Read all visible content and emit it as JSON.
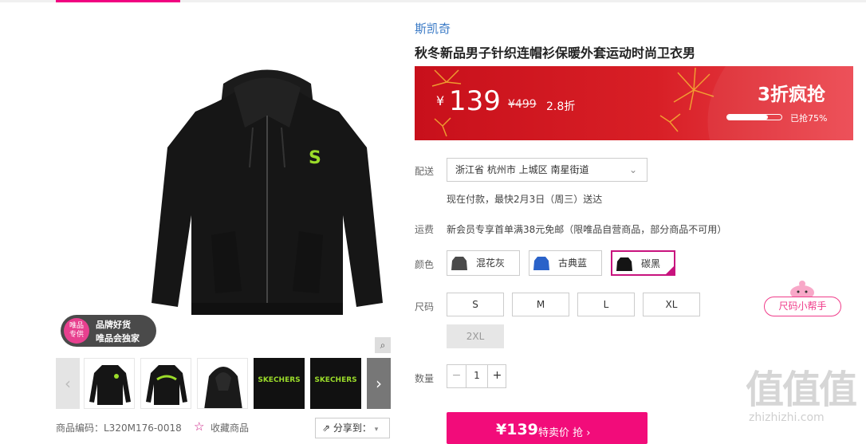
{
  "brand": "斯凯奇",
  "title": "秋冬新品男子针织连帽衫保暖外套运动时尚卫衣男",
  "product_image": {
    "badge_logo_line1": "唯品",
    "badge_logo_line2": "专供",
    "badge_line1": "品牌好货",
    "badge_line2": "唯品会独家",
    "hoodie_logo": "S"
  },
  "thumbnails": {
    "prev_icon": "chevron-left-icon",
    "next_icon": "chevron-right-icon",
    "texts": [
      "SKECHERS",
      "SKECHERS"
    ]
  },
  "sku_code": "商品编码：L320M176-0018",
  "favorite": "收藏商品",
  "share": "分享到：",
  "price_banner": {
    "currency": "¥",
    "price": "139",
    "original": "¥499",
    "discount": "2.8折",
    "promo": "3折疯抢",
    "sold_label": "已抢75%",
    "sold_fraction": 0.75
  },
  "delivery": {
    "label": "配送",
    "address": "浙江省 杭州市 上城区 南星街道",
    "eta": "现在付款，最快2月3日（周三）送达"
  },
  "shipping": {
    "label": "运费",
    "text": "新会员专享首单满38元免邮（限唯品自营商品，部分商品不可用）"
  },
  "colors": {
    "label": "颜色",
    "options": [
      {
        "name": "混花灰",
        "swatch": "#4a4a4a"
      },
      {
        "name": "古典蓝",
        "swatch": "#2a62c9"
      },
      {
        "name": "碳黑",
        "swatch": "#141414"
      }
    ],
    "selected": "碳黑"
  },
  "sizes": {
    "label": "尺码",
    "options": [
      "S",
      "M",
      "L",
      "XL",
      "2XL"
    ],
    "disabled": [
      "2XL"
    ],
    "helper": "尺码小帮手"
  },
  "quantity": {
    "label": "数量",
    "value": "1",
    "minus": "−",
    "plus": "+"
  },
  "buy": {
    "price": "¥139",
    "label": "特卖价 抢 ›"
  },
  "watermark": {
    "big": "值值值",
    "small": "zhizhizhi.com"
  },
  "colors_theme": {
    "accent": "#f10180",
    "banner_red": "#d81f26",
    "brand_blue": "#3a7ac6"
  }
}
